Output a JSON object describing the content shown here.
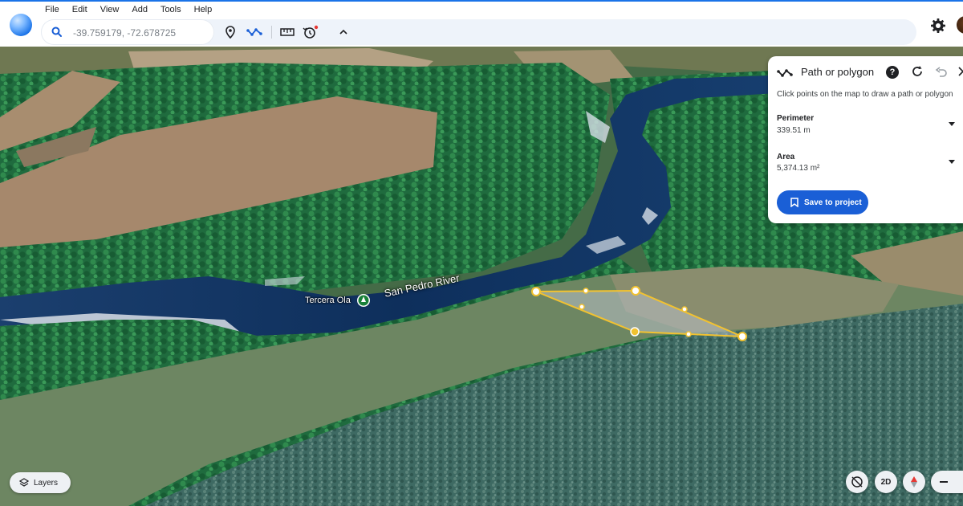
{
  "menu": [
    "File",
    "Edit",
    "View",
    "Add",
    "Tools",
    "Help"
  ],
  "search": {
    "placeholder": "-39.759179, -72.678725"
  },
  "toolbar_icons": [
    "place-marker-icon",
    "path-polygon-icon",
    "ruler-icon",
    "historical-imagery-icon",
    "collapse-chevron-icon"
  ],
  "header_right": {
    "settings_icon": "gear-icon",
    "avatar": "account-avatar"
  },
  "map": {
    "place_label": "Tercera Ola",
    "river_label": "San Pedro River"
  },
  "panel": {
    "title": "Path or polygon",
    "hint": "Click points on the map to draw a path or polygon",
    "perimeter": {
      "label": "Perimeter",
      "value": "339.51 m"
    },
    "area": {
      "label": "Area",
      "value": "5,374.13 m²"
    },
    "save_label": "Save to project"
  },
  "controls": {
    "layers_label": "Layers",
    "view_toggle_label": "2D"
  },
  "colors": {
    "accent": "#1a73e8",
    "save_button": "#1a5fd6",
    "polygon_stroke": "#f2c230",
    "river": "#0e2f5c"
  }
}
